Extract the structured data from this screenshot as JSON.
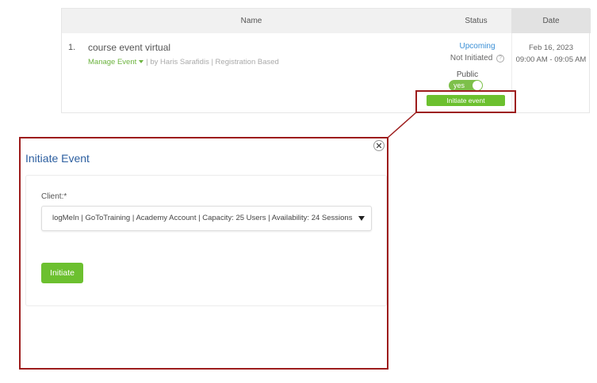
{
  "table": {
    "headers": {
      "name": "Name",
      "status": "Status",
      "date": "Date"
    },
    "rows": [
      {
        "number": "1.",
        "title": "course event virtual",
        "manage_label": "Manage Event",
        "meta": "| by Haris Sarafidis | Registration Based",
        "status": "Upcoming",
        "state": "Not Initiated",
        "public_label": "Public",
        "public_toggle": "yes",
        "initiate_label": "Initiate event",
        "date": "Feb 16, 2023",
        "time": "09:00 AM - 09:05 AM"
      }
    ]
  },
  "modal": {
    "title": "Initiate Event",
    "client_label": "Client:*",
    "client_value": "logMeIn | GoToTraining | Academy Account | Capacity: 25 Users | Availability: 24 Sessions",
    "initiate_label": "Initiate"
  },
  "colors": {
    "accent_green": "#6cc02f",
    "link_blue": "#3a8fd6",
    "title_blue": "#2d5fa0",
    "highlight_red": "#9d1c1c"
  }
}
